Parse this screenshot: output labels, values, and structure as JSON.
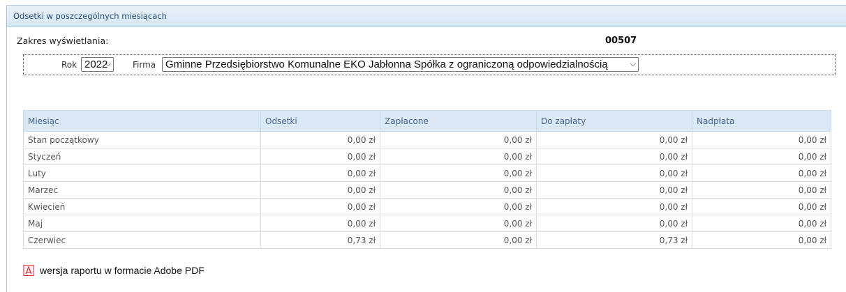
{
  "panel": {
    "title": "Odsetki w poszczególnych miesiącach"
  },
  "filters": {
    "range_label": "Zakres wyświetlania:",
    "account_number": "00507",
    "year_label": "Rok",
    "year_value": "2022",
    "company_label": "Firma",
    "company_value": "Gminne Przedsiębiorstwo Komunalne EKO Jabłonna Spółka z ograniczoną odpowiedzialnością"
  },
  "table": {
    "headers": [
      "Miesiąc",
      "Odsetki",
      "Zapłacone",
      "Do zapłaty",
      "Nadpłata"
    ],
    "rows": [
      [
        "Stan początkowy",
        "0,00 zł",
        "0,00 zł",
        "0,00 zł",
        "0,00 zł"
      ],
      [
        "Styczeń",
        "0,00 zł",
        "0,00 zł",
        "0,00 zł",
        "0,00 zł"
      ],
      [
        "Luty",
        "0,00 zł",
        "0,00 zł",
        "0,00 zł",
        "0,00 zł"
      ],
      [
        "Marzec",
        "0,00 zł",
        "0,00 zł",
        "0,00 zł",
        "0,00 zł"
      ],
      [
        "Kwiecień",
        "0,00 zł",
        "0,00 zł",
        "0,00 zł",
        "0,00 zł"
      ],
      [
        "Maj",
        "0,00 zł",
        "0,00 zł",
        "0,00 zł",
        "0,00 zł"
      ],
      [
        "Czerwiec",
        "0,73 zł",
        "0,00 zł",
        "0,73 zł",
        "0,00 zł"
      ]
    ]
  },
  "footer": {
    "pdf_link": "wersja raportu w formacie Adobe PDF",
    "pdf_icon": "pdf-icon"
  },
  "colors": {
    "header_background": "#dbe8f6",
    "header_text": "#46648a",
    "panel_border": "#a9c5e0",
    "pdf_icon": "#e02020"
  }
}
